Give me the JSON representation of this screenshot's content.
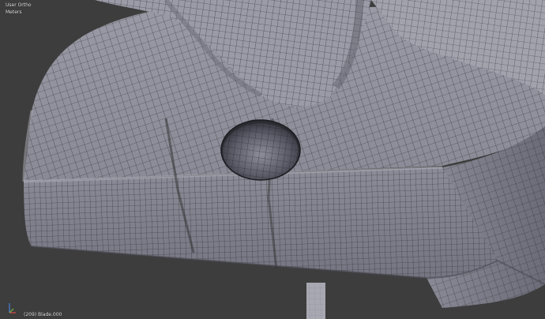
{
  "viewport": {
    "view_name": "User Ortho",
    "units": "Meters",
    "object_info": "(209) Blade.000"
  },
  "scene": {
    "background_color": "#3d3d3d",
    "mesh_color": "#8d8d99",
    "wire_color": "#1a1a1a"
  },
  "gizmo": {
    "x_color": "#e04a4a",
    "y_color": "#6fbf3a",
    "z_color": "#4a7fe0"
  }
}
